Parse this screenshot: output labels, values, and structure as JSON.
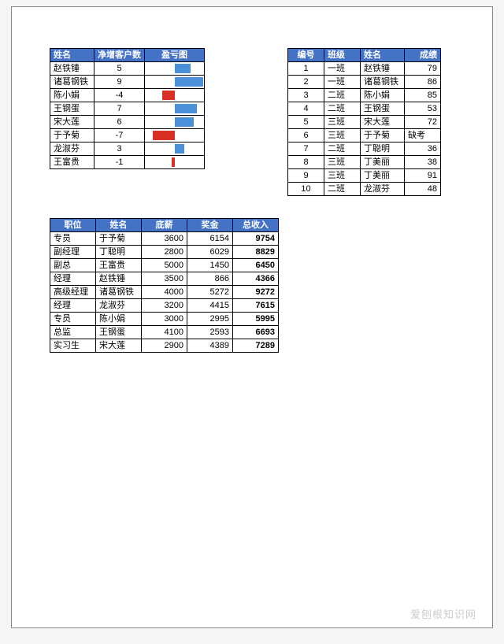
{
  "table1": {
    "headers": [
      "姓名",
      "净增客户数",
      "盈亏图"
    ],
    "rows": [
      {
        "name": "赵铁锤",
        "value": 5
      },
      {
        "name": "诸葛钢铁",
        "value": 9
      },
      {
        "name": "陈小娟",
        "value": -4
      },
      {
        "name": "王钢蛋",
        "value": 7
      },
      {
        "name": "宋大莲",
        "value": 6
      },
      {
        "name": "于予菊",
        "value": -7
      },
      {
        "name": "龙淑芬",
        "value": 3
      },
      {
        "name": "王富贵",
        "value": -1
      }
    ]
  },
  "table2": {
    "headers": [
      "编号",
      "班级",
      "姓名",
      "成绩"
    ],
    "rows": [
      {
        "id": 1,
        "class": "一班",
        "name": "赵铁锤",
        "score": "79"
      },
      {
        "id": 2,
        "class": "一班",
        "name": "诸葛钢铁",
        "score": "86"
      },
      {
        "id": 3,
        "class": "二班",
        "name": "陈小娟",
        "score": "85"
      },
      {
        "id": 4,
        "class": "二班",
        "name": "王钢蛋",
        "score": "53"
      },
      {
        "id": 5,
        "class": "三班",
        "name": "宋大莲",
        "score": "72"
      },
      {
        "id": 6,
        "class": "三班",
        "name": "于予菊",
        "score": "缺考"
      },
      {
        "id": 7,
        "class": "二班",
        "name": "丁聪明",
        "score": "36"
      },
      {
        "id": 8,
        "class": "三班",
        "name": "丁美丽",
        "score": "38"
      },
      {
        "id": 9,
        "class": "三班",
        "name": "丁美丽",
        "score": "91"
      },
      {
        "id": 10,
        "class": "二班",
        "name": "龙淑芬",
        "score": "48"
      }
    ]
  },
  "table3": {
    "headers": [
      "职位",
      "姓名",
      "底薪",
      "奖金",
      "总收入"
    ],
    "rows": [
      {
        "pos": "专员",
        "name": "于予菊",
        "base": 3600,
        "bonus": 6154,
        "total": 9754
      },
      {
        "pos": "副经理",
        "name": "丁聪明",
        "base": 2800,
        "bonus": 6029,
        "total": 8829
      },
      {
        "pos": "副总",
        "name": "王富贵",
        "base": 5000,
        "bonus": 1450,
        "total": 6450
      },
      {
        "pos": "经理",
        "name": "赵铁锤",
        "base": 3500,
        "bonus": 866,
        "total": 4366
      },
      {
        "pos": "高级经理",
        "name": "诸葛钢铁",
        "base": 4000,
        "bonus": 5272,
        "total": 9272
      },
      {
        "pos": "经理",
        "name": "龙淑芬",
        "base": 3200,
        "bonus": 4415,
        "total": 7615
      },
      {
        "pos": "专员",
        "name": "陈小娟",
        "base": 3000,
        "bonus": 2995,
        "total": 5995
      },
      {
        "pos": "总监",
        "name": "王钢蛋",
        "base": 4100,
        "bonus": 2593,
        "total": 6693
      },
      {
        "pos": "实习生",
        "name": "宋大莲",
        "base": 2900,
        "bonus": 4389,
        "total": 7289
      }
    ]
  },
  "chart_data": {
    "type": "bar",
    "title": "盈亏图",
    "categories": [
      "赵铁锤",
      "诸葛钢铁",
      "陈小娟",
      "王钢蛋",
      "宋大莲",
      "于予菊",
      "龙淑芬",
      "王富贵"
    ],
    "values": [
      5,
      9,
      -4,
      7,
      6,
      -7,
      3,
      -1
    ],
    "xlabel": "",
    "ylabel": "净增客户数",
    "ylim": [
      -9,
      9
    ],
    "colors": {
      "positive": "#4a90d9",
      "negative": "#d93025"
    }
  },
  "watermark": "爱刨根知识网"
}
